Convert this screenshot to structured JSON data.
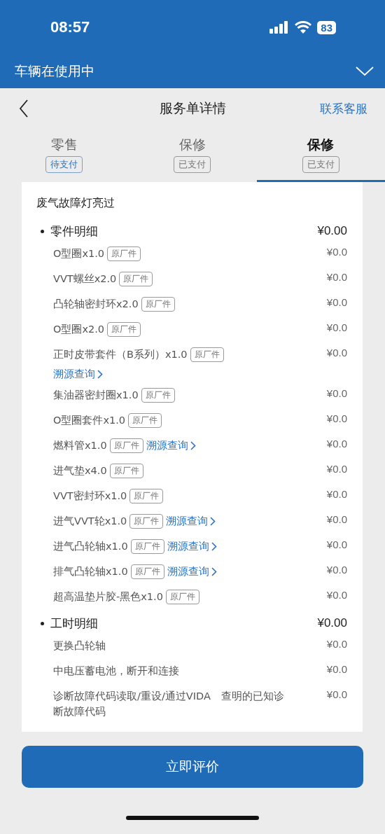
{
  "status_bar": {
    "time": "08:57",
    "battery": "83"
  },
  "banner": {
    "title": "车辆在使用中"
  },
  "nav": {
    "title": "服务单详情",
    "action": "联系客服"
  },
  "tabs": [
    {
      "label": "零售",
      "badge": "待支付",
      "kind": "pending",
      "selected": false
    },
    {
      "label": "保修",
      "badge": "已支付",
      "kind": "paid",
      "selected": false
    },
    {
      "label": "保修",
      "badge": "已支付",
      "kind": "paid",
      "selected": true
    }
  ],
  "card": {
    "title": "废气故障灯亮过",
    "sections": [
      {
        "kind": "parts",
        "title": "零件明细",
        "total": "¥0.00",
        "items": [
          {
            "name": "O型圈x1.0",
            "tag": "原厂件",
            "price": "¥0.0"
          },
          {
            "name": "VVT螺丝x2.0",
            "tag": "原厂件",
            "price": "¥0.0"
          },
          {
            "name": "凸轮轴密封环x2.0",
            "tag": "原厂件",
            "price": "¥0.0"
          },
          {
            "name": "O型圈x2.0",
            "tag": "原厂件",
            "price": "¥0.0"
          },
          {
            "name": "正时皮带套件（B系列）x1.0",
            "tag": "原厂件",
            "link": "溯源查询",
            "price": "¥0.0"
          },
          {
            "name": "集油器密封圈x1.0",
            "tag": "原厂件",
            "price": "¥0.0"
          },
          {
            "name": "O型圈套件x1.0",
            "tag": "原厂件",
            "price": "¥0.0"
          },
          {
            "name": "燃料管x1.0",
            "tag": "原厂件",
            "link": "溯源查询",
            "price": "¥0.0"
          },
          {
            "name": "进气垫x4.0",
            "tag": "原厂件",
            "price": "¥0.0"
          },
          {
            "name": "VVT密封环x1.0",
            "tag": "原厂件",
            "price": "¥0.0"
          },
          {
            "name": "进气VVT轮x1.0",
            "tag": "原厂件",
            "link": "溯源查询",
            "price": "¥0.0"
          },
          {
            "name": "进气凸轮轴x1.0",
            "tag": "原厂件",
            "link": "溯源查询",
            "price": "¥0.0"
          },
          {
            "name": "排气凸轮轴x1.0",
            "tag": "原厂件",
            "link": "溯源查询",
            "price": "¥0.0"
          },
          {
            "name": "超高温垫片胶-黑色x1.0",
            "tag": "原厂件",
            "price": "¥0.0"
          }
        ]
      },
      {
        "kind": "labor",
        "title": "工时明细",
        "total": "¥0.00",
        "items": [
          {
            "name": "更换凸轮轴",
            "price": "¥0.0"
          },
          {
            "name": "中电压蓄电池，断开和连接",
            "price": "¥0.0"
          },
          {
            "name": "诊断故障代码读取/重设/通过VIDA　查明的已知诊断故障代码",
            "price": "¥0.0"
          }
        ]
      }
    ]
  },
  "footer": {
    "button": "立即评价"
  }
}
